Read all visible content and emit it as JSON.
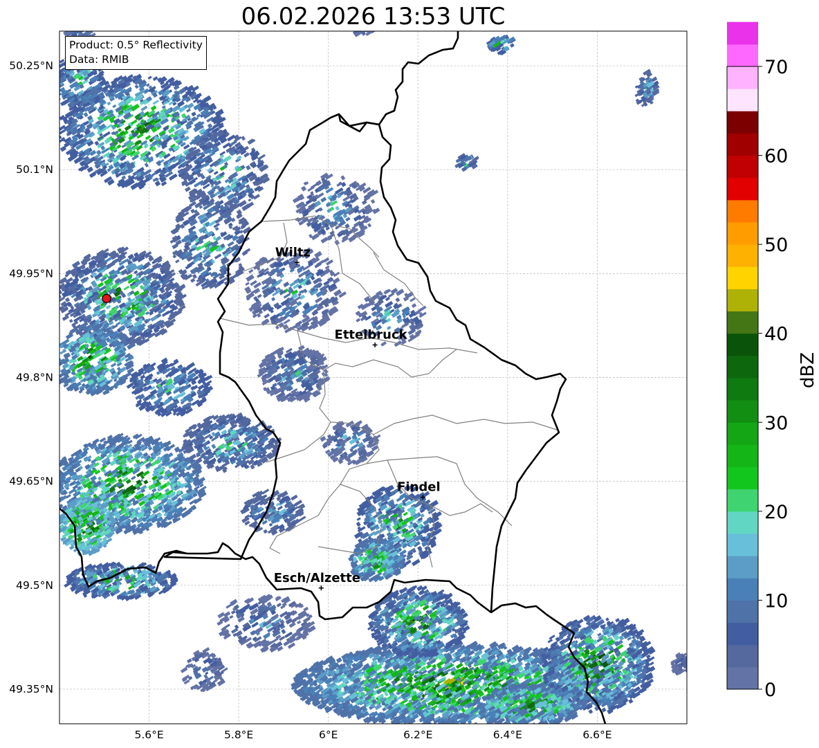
{
  "title": "06.02.2026 13:53 UTC",
  "info": {
    "product": "Product: 0.5° Reflectivity",
    "data_source": "Data: RMIB"
  },
  "map": {
    "lon_range": [
      5.4,
      6.8
    ],
    "lat_range": [
      49.3,
      50.3
    ],
    "lon_ticks": [
      {
        "value": 5.6,
        "label": "5.6°E"
      },
      {
        "value": 5.8,
        "label": "5.8°E"
      },
      {
        "value": 6.0,
        "label": "6°E"
      },
      {
        "value": 6.2,
        "label": "6.2°E"
      },
      {
        "value": 6.4,
        "label": "6.4°E"
      },
      {
        "value": 6.6,
        "label": "6.6°E"
      }
    ],
    "lat_ticks": [
      {
        "value": 50.25,
        "label": "50.25°N"
      },
      {
        "value": 50.1,
        "label": "50.1°N"
      },
      {
        "value": 49.95,
        "label": "49.95°N"
      },
      {
        "value": 49.8,
        "label": "49.8°N"
      },
      {
        "value": 49.65,
        "label": "49.65°N"
      },
      {
        "value": 49.5,
        "label": "49.5°N"
      },
      {
        "value": 49.35,
        "label": "49.35°N"
      }
    ],
    "gridlines": true,
    "cities": [
      {
        "name": "Wiltz",
        "lon": 5.93,
        "lat": 49.966
      },
      {
        "name": "Ettelbruck",
        "lon": 6.104,
        "lat": 49.847
      },
      {
        "name": "Findel",
        "lon": 6.211,
        "lat": 49.627
      },
      {
        "name": "Esch/Alzette",
        "lon": 5.984,
        "lat": 49.496
      }
    ],
    "radar_site": {
      "lon": 5.505,
      "lat": 49.914
    },
    "border_color": "#000000",
    "canton_color": "#808080"
  },
  "colorbar": {
    "label": "dBZ",
    "min": 0,
    "max": 70,
    "step": 2.5,
    "ticks": [
      "0",
      "10",
      "20",
      "30",
      "40",
      "50",
      "60",
      "70"
    ],
    "colors": [
      "#6473a6",
      "#55699f",
      "#435ea0",
      "#4f72a9",
      "#4a80b8",
      "#5b9dc6",
      "#68bfd9",
      "#61d6c2",
      "#3fd46f",
      "#13c61d",
      "#14b617",
      "#14a615",
      "#128e12",
      "#0f7a10",
      "#0d680d",
      "#0a540a",
      "#457615",
      "#aeb106",
      "#fed300",
      "#feb100",
      "#fe9c00",
      "#fe7b00",
      "#e20000",
      "#c00000",
      "#a00000",
      "#7c0000",
      "#ffe4ff",
      "#ffb3ff",
      "#ff68ff",
      "#ea32ea"
    ]
  }
}
